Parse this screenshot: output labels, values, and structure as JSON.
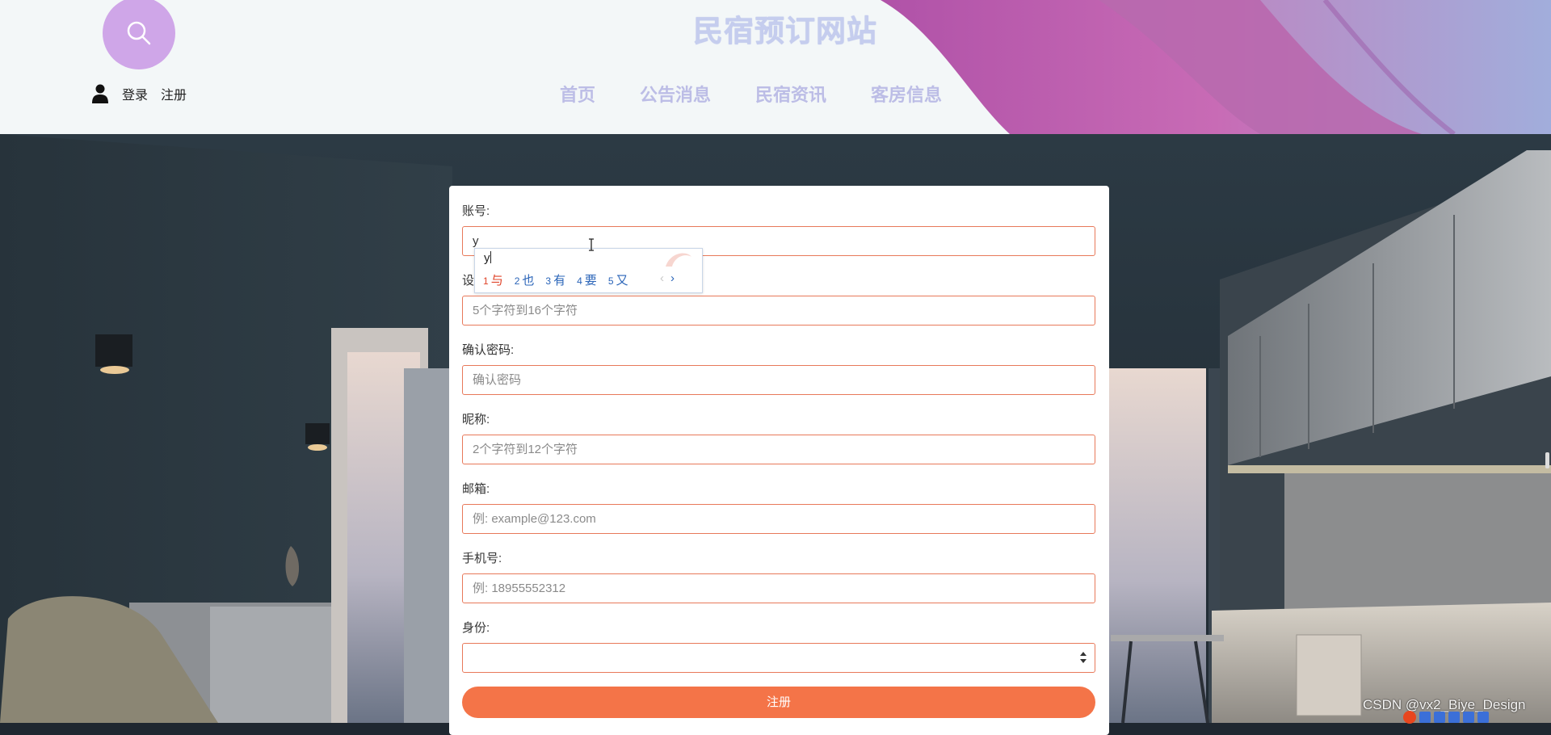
{
  "header": {
    "site_title": "民宿预订网站",
    "login_label": "登录",
    "register_label": "注册",
    "nav": [
      {
        "label": "首页"
      },
      {
        "label": "公告消息"
      },
      {
        "label": "民宿资讯"
      },
      {
        "label": "客房信息"
      }
    ]
  },
  "form": {
    "account": {
      "label": "账号:",
      "value": "y"
    },
    "password": {
      "label": "设",
      "placeholder": "5个字符到16个字符"
    },
    "confirm": {
      "label": "确认密码:",
      "placeholder": "确认密码"
    },
    "nickname": {
      "label": "昵称:",
      "placeholder": "2个字符到12个字符"
    },
    "email": {
      "label": "邮箱:",
      "placeholder": "例: example@123.com"
    },
    "phone": {
      "label": "手机号:",
      "placeholder": "例: 18955552312"
    },
    "role": {
      "label": "身份:",
      "value": ""
    },
    "submit_label": "注册"
  },
  "ime": {
    "composition": "y",
    "candidates": [
      {
        "n": "1",
        "text": "与"
      },
      {
        "n": "2",
        "text": "也"
      },
      {
        "n": "3",
        "text": "有"
      },
      {
        "n": "4",
        "text": "要"
      },
      {
        "n": "5",
        "text": "又"
      }
    ],
    "prev": "‹",
    "next": "›"
  },
  "watermark": "CSDN @vx2_Biye_Design",
  "colors": {
    "accent": "#f47448",
    "input_border": "#e8795a",
    "nav_text": "#bcbde6",
    "title": "#c5cdee",
    "search_circle": "#cfa6e8"
  },
  "icons": [
    "search-icon",
    "user-icon",
    "select-arrows-icon",
    "text-cursor-icon"
  ]
}
